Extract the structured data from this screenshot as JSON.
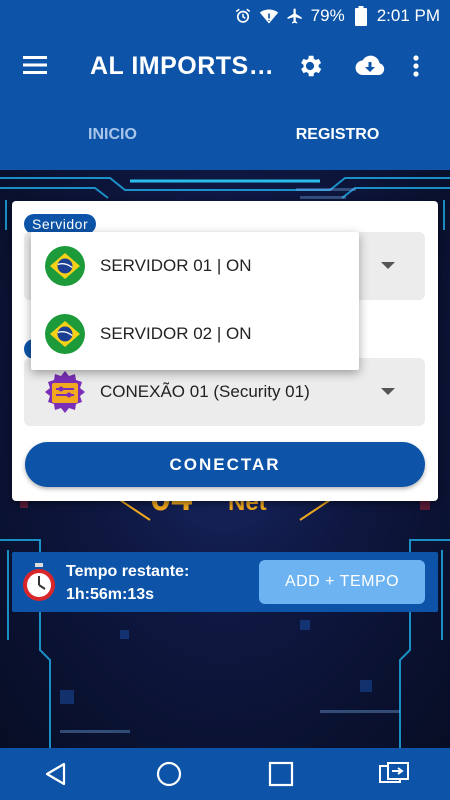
{
  "status_bar": {
    "battery": "79%",
    "time": "2:01 PM"
  },
  "app_bar": {
    "title": "AL IMPORTS…"
  },
  "tabs": [
    {
      "label": "INICIO",
      "active": false
    },
    {
      "label": "REGISTRO",
      "active": true
    }
  ],
  "card": {
    "servidor_label": "Servidor",
    "servers": [
      "SERVIDOR 01 | ON",
      "SERVIDOR 02 | ON"
    ],
    "connection_value": "CONEXÃO 01 (Security 01)",
    "connect_button": "CONECTAR"
  },
  "timer": {
    "label": "Tempo restante:",
    "value": "1h:56m:13s",
    "add_button": "ADD + TEMPO"
  },
  "colors": {
    "primary": "#0d54a8",
    "accent": "#6db3f2",
    "timer_red": "#d8262b"
  },
  "icons": [
    "alarm-icon",
    "wifi-icon",
    "airplane-icon",
    "battery-icon",
    "menu-icon",
    "settings-icon",
    "cloud-download-icon",
    "more-vert-icon",
    "brazil-flag-icon",
    "gear-plugin-icon",
    "stopwatch-icon",
    "back-icon",
    "home-icon",
    "recents-icon",
    "screen-share-icon"
  ]
}
